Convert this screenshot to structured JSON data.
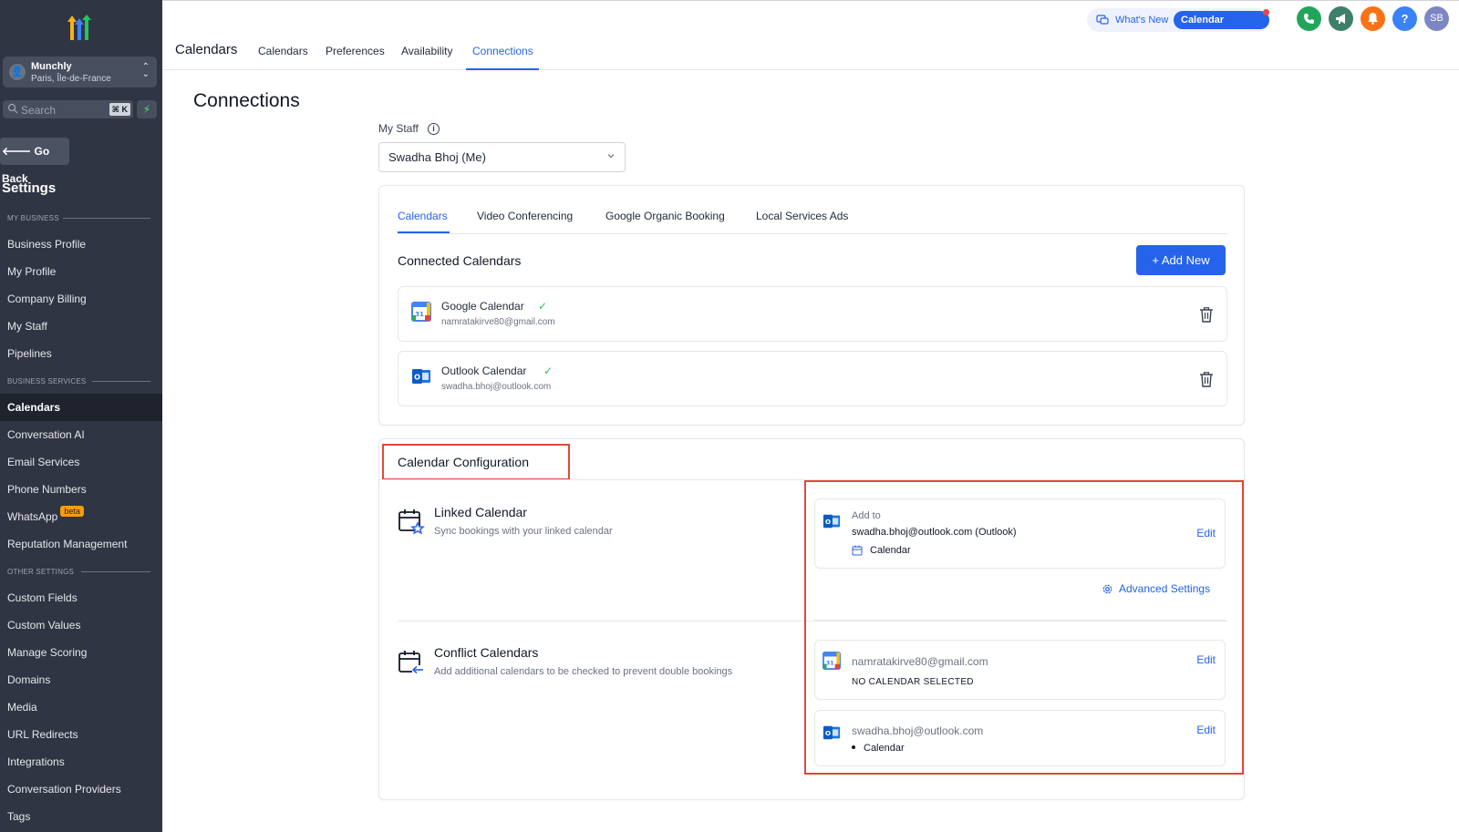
{
  "sidebar": {
    "location": {
      "name": "Munchly",
      "sub": "Paris, Île-de-France",
      "avatar": "👤"
    },
    "search": {
      "placeholder": "Search",
      "shortcut": "⌘ K"
    },
    "go_back": "🡐 Go Back",
    "settings_title": "Settings",
    "sections": {
      "my_business": "MY BUSINESS",
      "business_services": "BUSINESS SERVICES",
      "other_settings": "OTHER SETTINGS"
    },
    "items": [
      {
        "label": "Business Profile"
      },
      {
        "label": "My Profile"
      },
      {
        "label": "Company Billing"
      },
      {
        "label": "My Staff"
      },
      {
        "label": "Pipelines"
      },
      {
        "label": "Calendars",
        "active": true
      },
      {
        "label": "Conversation AI"
      },
      {
        "label": "Email Services"
      },
      {
        "label": "Phone Numbers"
      },
      {
        "label": "WhatsApp",
        "badge": "beta"
      },
      {
        "label": "Reputation Management"
      },
      {
        "label": "Custom Fields"
      },
      {
        "label": "Custom Values"
      },
      {
        "label": "Manage Scoring"
      },
      {
        "label": "Domains"
      },
      {
        "label": "Media"
      },
      {
        "label": "URL Redirects"
      },
      {
        "label": "Integrations"
      },
      {
        "label": "Conversation Providers"
      },
      {
        "label": "Tags"
      }
    ]
  },
  "topbar": {
    "title": "Calendars",
    "tabs": [
      "Calendars",
      "Preferences",
      "Availability",
      "Connections"
    ],
    "active_tab": "Connections",
    "whats_new": "What's New",
    "calendar_updates": "Calendar Updates",
    "avatar_initials": "SB",
    "help": "?"
  },
  "page": {
    "title": "Connections",
    "my_staff_label": "My Staff",
    "my_staff_value": "Swadha Bhoj (Me)",
    "info": "i"
  },
  "connections_card": {
    "tabs": [
      "Calendars",
      "Video Conferencing",
      "Google Organic Booking",
      "Local Services Ads"
    ],
    "section_title": "Connected Calendars",
    "add_new": "+ Add New",
    "calendars": [
      {
        "name": "Google Calendar",
        "email": "namratakirve80@gmail.com",
        "check": "✓"
      },
      {
        "name": "Outlook Calendar",
        "email": "swadha.bhoj@outlook.com",
        "check": "✓"
      }
    ]
  },
  "config_card": {
    "title": "Calendar Configuration",
    "linked": {
      "title": "Linked Calendar",
      "desc": "Sync bookings with your linked calendar",
      "add_to_label": "Add to",
      "account": "swadha.bhoj@outlook.com (Outlook)",
      "calendar": "Calendar",
      "edit": "Edit",
      "advanced": "Advanced Settings"
    },
    "conflict": {
      "title": "Conflict Calendars",
      "desc": "Add additional calendars to be checked to prevent double bookings",
      "items": [
        {
          "email": "namratakirve80@gmail.com",
          "detail": "NO CALENDAR SELECTED",
          "edit": "Edit"
        },
        {
          "email": "swadha.bhoj@outlook.com",
          "detail": "Calendar",
          "edit": "Edit"
        }
      ]
    }
  },
  "colors": {
    "sidebar_bg": "#2f3542",
    "accent": "#2563eb",
    "highlight": "#dc4a3a",
    "phone_btn": "#22a55b",
    "megaphone_btn": "#3d7f6a",
    "bell_btn": "#f97316",
    "help_btn": "#3b82f6",
    "avatar_btn": "#7c86c4"
  }
}
